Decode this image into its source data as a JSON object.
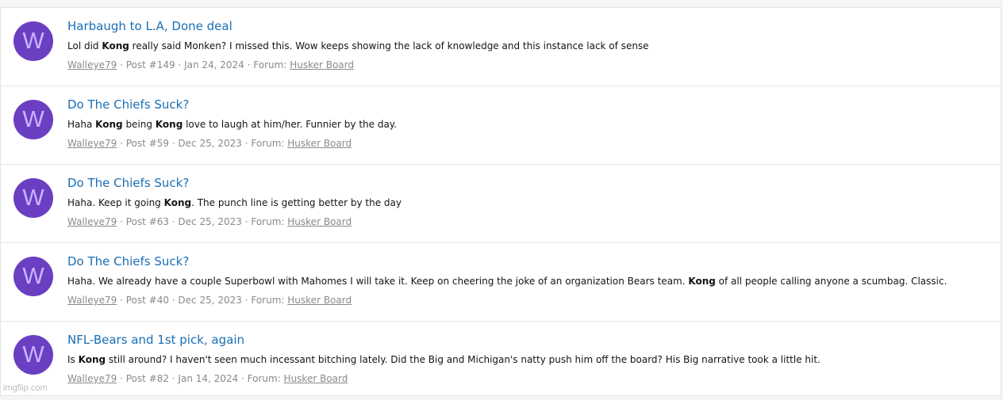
{
  "results": [
    {
      "avatar_letter": "W",
      "title": "Harbaugh to L.A, Done deal",
      "snippet": [
        {
          "text": "Lol did ",
          "bold": false
        },
        {
          "text": "Kong",
          "bold": true
        },
        {
          "text": " really said Monken? I missed this. Wow keeps showing the lack of knowledge and this instance lack of sense",
          "bold": false
        }
      ],
      "author": "Walleye79",
      "post": "Post #149",
      "date": "Jan 24, 2024",
      "forum_label": "Forum:",
      "forum": "Husker Board"
    },
    {
      "avatar_letter": "W",
      "title": "Do The Chiefs Suck?",
      "snippet": [
        {
          "text": "Haha ",
          "bold": false
        },
        {
          "text": "Kong",
          "bold": true
        },
        {
          "text": " being ",
          "bold": false
        },
        {
          "text": "Kong",
          "bold": true
        },
        {
          "text": " love to laugh at him/her. Funnier by the day.",
          "bold": false
        }
      ],
      "author": "Walleye79",
      "post": "Post #59",
      "date": "Dec 25, 2023",
      "forum_label": "Forum:",
      "forum": "Husker Board"
    },
    {
      "avatar_letter": "W",
      "title": "Do The Chiefs Suck?",
      "snippet": [
        {
          "text": "Haha. Keep it going ",
          "bold": false
        },
        {
          "text": "Kong",
          "bold": true
        },
        {
          "text": ". The punch line is getting better by the day",
          "bold": false
        }
      ],
      "author": "Walleye79",
      "post": "Post #63",
      "date": "Dec 25, 2023",
      "forum_label": "Forum:",
      "forum": "Husker Board"
    },
    {
      "avatar_letter": "W",
      "title": "Do The Chiefs Suck?",
      "snippet": [
        {
          "text": "Haha. We already have a couple Superbowl with Mahomes I will take it. Keep on cheering the joke of an organization Bears team. ",
          "bold": false
        },
        {
          "text": "Kong",
          "bold": true
        },
        {
          "text": " of all people calling anyone a scumbag. Classic.",
          "bold": false
        }
      ],
      "author": "Walleye79",
      "post": "Post #40",
      "date": "Dec 25, 2023",
      "forum_label": "Forum:",
      "forum": "Husker Board"
    },
    {
      "avatar_letter": "W",
      "title": "NFL-Bears and 1st pick, again",
      "snippet": [
        {
          "text": "Is ",
          "bold": false
        },
        {
          "text": "Kong",
          "bold": true
        },
        {
          "text": " still around? I haven't seen much incessant bitching lately. Did the Big and Michigan's natty push him off the board? His Big narrative took a little hit.",
          "bold": false
        }
      ],
      "author": "Walleye79",
      "post": "Post #82",
      "date": "Jan 14, 2024",
      "forum_label": "Forum:",
      "forum": "Husker Board"
    }
  ],
  "separator": " · ",
  "watermark": "imgflip.com",
  "colors": {
    "avatar_bg": "#6a3fc2",
    "avatar_letter": "#c9b5ff",
    "title_link": "#1a6fb5",
    "meta_text": "#8a8a8a"
  }
}
